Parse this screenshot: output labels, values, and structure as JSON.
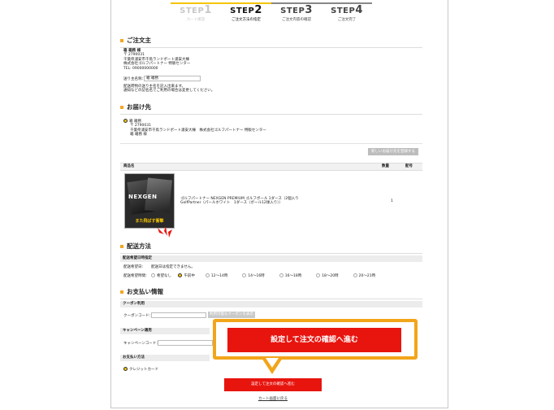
{
  "steps": [
    {
      "prefix": "STEP",
      "num": "1",
      "sub": "カート確認",
      "state": "done"
    },
    {
      "prefix": "STEP",
      "num": "2",
      "sub": "ご注文方法の指定",
      "state": "current"
    },
    {
      "prefix": "STEP",
      "num": "3",
      "sub": "ご注文内容の確認",
      "state": "todo"
    },
    {
      "prefix": "STEP",
      "num": "4",
      "sub": "ご注文完了",
      "state": "todo"
    }
  ],
  "orderer": {
    "heading": "ご注文主",
    "name": "箱 箱務 様",
    "zip": "〒 2790031",
    "address": "千葉県浦安市千鳥ランドポート浦安大棟",
    "company": "株式会社ゴルフパートナー 特販センター",
    "tel": "TEL: 09000000000",
    "sender_label": "送り主名称：",
    "sender_value": "箱 箱務",
    "note1": "配送荷物の送り主名を記入出来ます。",
    "note2": "通知などの記名名でご利用の場合は変更してください。"
  },
  "delivery": {
    "heading": "お届け先",
    "name": "箱 箱務",
    "zip": "〒 2790031",
    "address": "千葉県浦安市千鳥ランドポート浦安大棟　株式会社ゴルフパートナー 特販センター",
    "person": "箱 箱務 様",
    "new_address_button": "新しいお届け先を登録する"
  },
  "product_table": {
    "col_name": "商品名",
    "col_qty": "数量",
    "col_ship": "配号",
    "product_name": "ゴルフパートナー NEXGEN PREMIUM ゴルフボール 1ダース（2個入り GolfPartner（パールホワイト　1ダース（ボール12球入り））",
    "qty": "1",
    "image_brand": "NEXGEN",
    "image_caption": "また飛ばす衝撃"
  },
  "shipping": {
    "heading": "配送方法",
    "bar": "配送希望日時指定",
    "date_label": "配送希望日：",
    "date_value": "配送日は指定できません。",
    "time_label": "配送希望時間：",
    "time_options": [
      "希望なし",
      "午前中",
      "12～14時",
      "14～16時",
      "16～18時",
      "18～20時",
      "20～21時"
    ],
    "time_selected": 1
  },
  "payment": {
    "heading": "お支払い情報",
    "coupon_bar": "クーポン利用",
    "coupon_label": "クーポンコード：",
    "coupon_button": "利用可能なクーポンを表示",
    "campaign_bar": "キャンペーン適用",
    "campaign_label": "キャンペーンコード：",
    "method_bar": "お支払い方法",
    "method_option": "クレジットカード"
  },
  "callout_button": "設定して注文の確認へ進む",
  "confirm_button": "設定して注文の確認へ進む",
  "back_link": "カート画面に戻る",
  "colors": {
    "accent": "#f5a623",
    "red": "#e8150f",
    "callout_border": "#f2a51a",
    "step_active": "#f5c400"
  }
}
